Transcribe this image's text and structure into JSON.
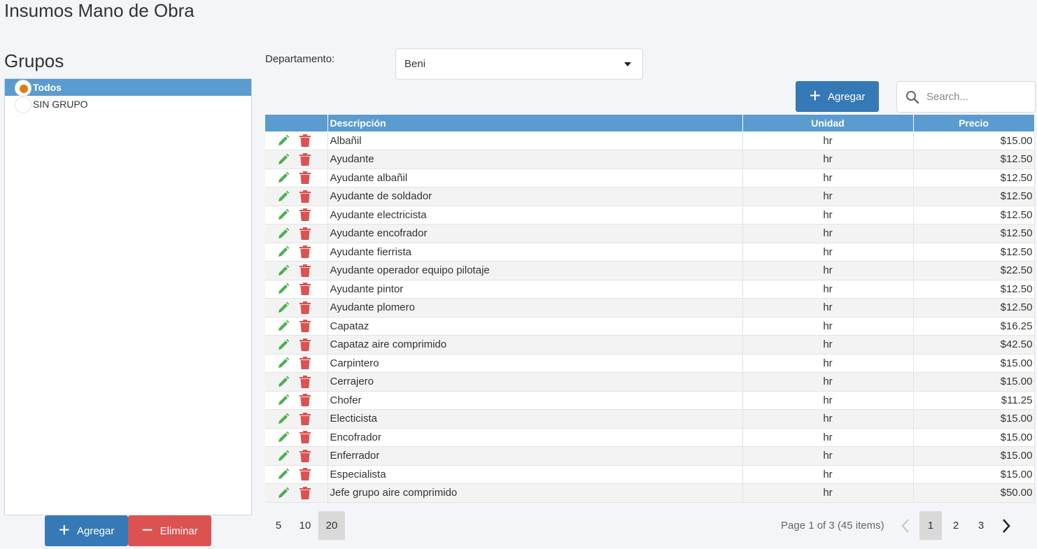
{
  "page": {
    "title": "Insumos Mano de Obra"
  },
  "groups": {
    "title": "Grupos",
    "items": [
      {
        "label": "Todos",
        "selected": true
      },
      {
        "label": "SIN GRUPO",
        "selected": false
      }
    ],
    "add_label": "Agregar",
    "delete_label": "Eliminar"
  },
  "filter": {
    "department_label": "Departamento:",
    "department_value": "Beni"
  },
  "toolbar": {
    "add_label": "Agregar",
    "search_placeholder": "Search..."
  },
  "table": {
    "columns": [
      "Descripción",
      "Unidad",
      "Precio"
    ],
    "rows": [
      {
        "desc": "Albañil",
        "unit": "hr",
        "price": "$15.00"
      },
      {
        "desc": "Ayudante",
        "unit": "hr",
        "price": "$12.50"
      },
      {
        "desc": "Ayudante albañil",
        "unit": "hr",
        "price": "$12.50"
      },
      {
        "desc": "Ayudante de soldador",
        "unit": "hr",
        "price": "$12.50"
      },
      {
        "desc": "Ayudante electricista",
        "unit": "hr",
        "price": "$12.50"
      },
      {
        "desc": "Ayudante encofrador",
        "unit": "hr",
        "price": "$12.50"
      },
      {
        "desc": "Ayudante fierrista",
        "unit": "hr",
        "price": "$12.50"
      },
      {
        "desc": "Ayudante operador equipo pilotaje",
        "unit": "hr",
        "price": "$22.50"
      },
      {
        "desc": "Ayudante pintor",
        "unit": "hr",
        "price": "$12.50"
      },
      {
        "desc": "Ayudante plomero",
        "unit": "hr",
        "price": "$12.50"
      },
      {
        "desc": "Capataz",
        "unit": "hr",
        "price": "$16.25"
      },
      {
        "desc": "Capataz aire comprimido",
        "unit": "hr",
        "price": "$42.50"
      },
      {
        "desc": "Carpintero",
        "unit": "hr",
        "price": "$15.00"
      },
      {
        "desc": "Cerrajero",
        "unit": "hr",
        "price": "$15.00"
      },
      {
        "desc": "Chofer",
        "unit": "hr",
        "price": "$11.25"
      },
      {
        "desc": "Electicista",
        "unit": "hr",
        "price": "$15.00"
      },
      {
        "desc": "Encofrador",
        "unit": "hr",
        "price": "$15.00"
      },
      {
        "desc": "Enferrador",
        "unit": "hr",
        "price": "$15.00"
      },
      {
        "desc": "Especialista",
        "unit": "hr",
        "price": "$15.00"
      },
      {
        "desc": "Jefe grupo aire comprimido",
        "unit": "hr",
        "price": "$50.00"
      }
    ]
  },
  "pager": {
    "sizes": [
      "5",
      "10",
      "20"
    ],
    "active_size": "20",
    "info": "Page 1 of 3 (45 items)",
    "pages": [
      "1",
      "2",
      "3"
    ],
    "active_page": "1"
  },
  "colors": {
    "header": "#5a9bd0",
    "primary_button": "#3579b6",
    "danger_button": "#dc5250",
    "edit_icon": "#4caf50",
    "delete_icon": "#dc5250",
    "radio_dot": "#e07b12"
  }
}
